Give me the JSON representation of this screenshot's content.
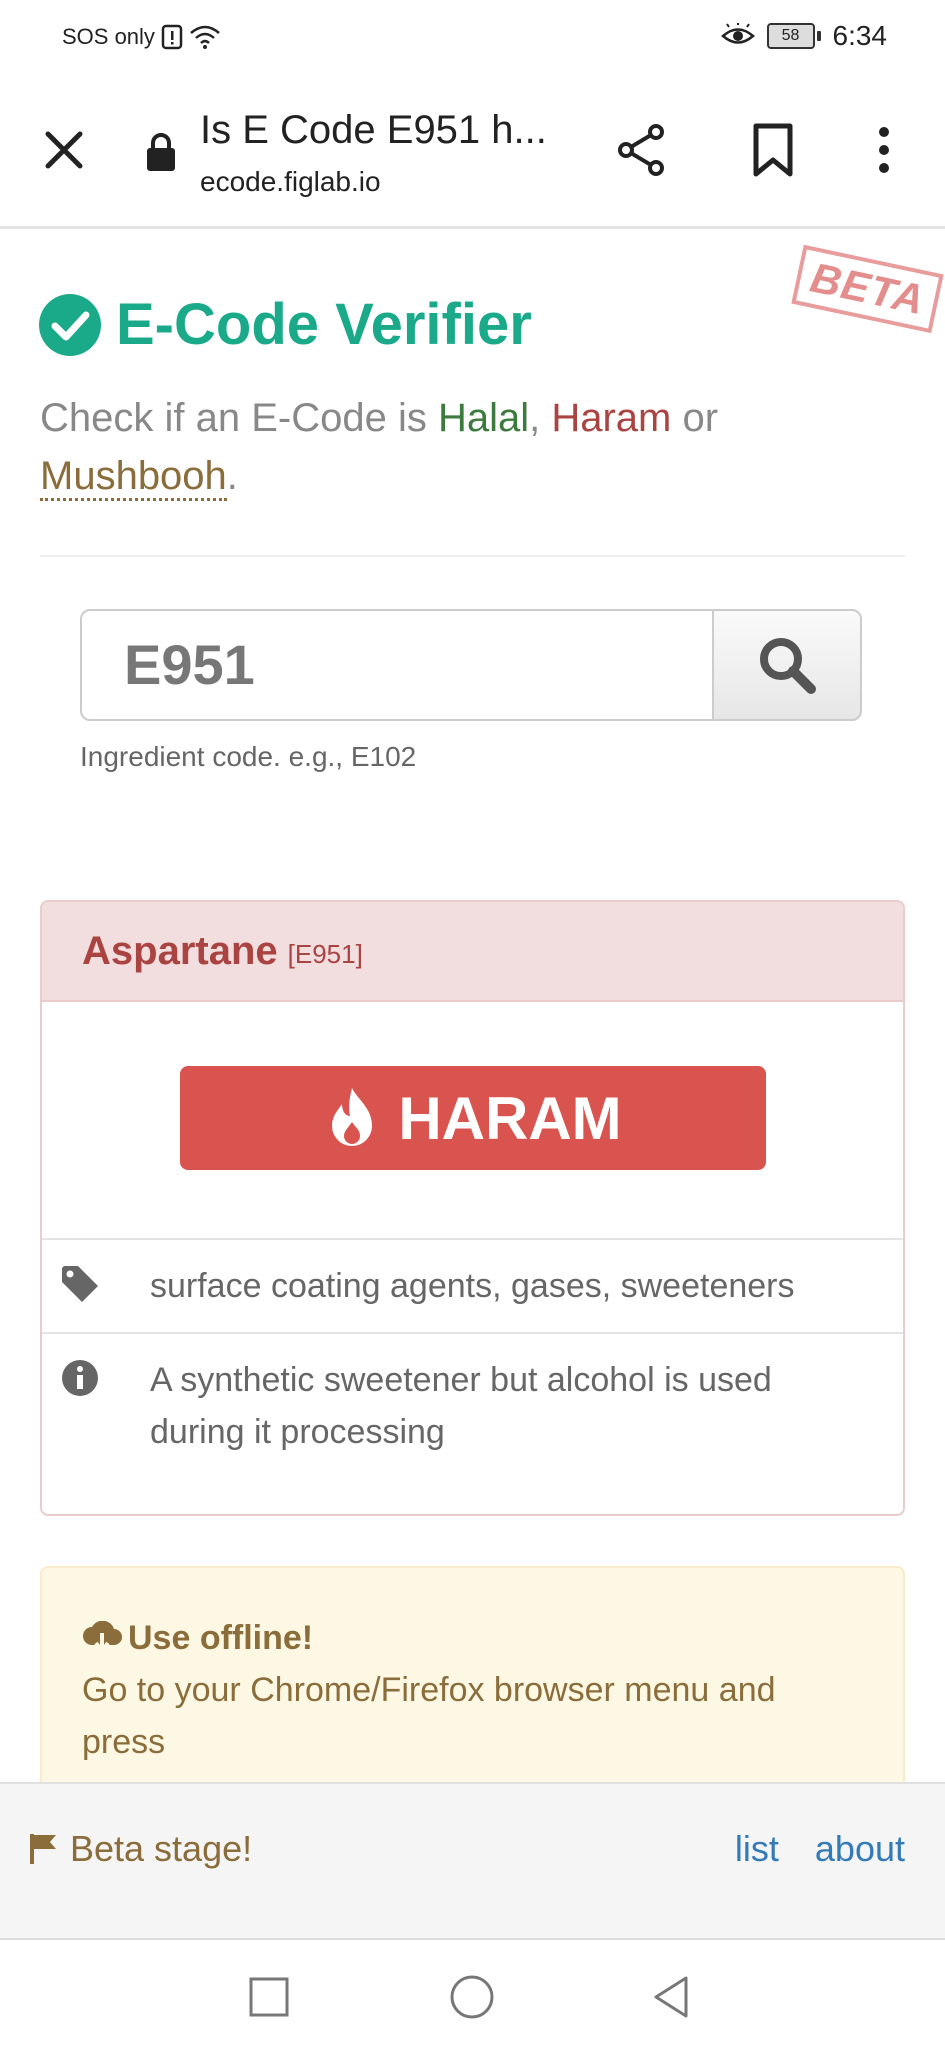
{
  "status_bar": {
    "carrier": "SOS only",
    "battery": "58",
    "time": "6:34"
  },
  "browser": {
    "title": "Is E Code E951 h...",
    "url": "ecode.figlab.io"
  },
  "page": {
    "beta_stamp": "BETA",
    "heading": "E-Code Verifier",
    "subtitle": {
      "prefix": "Check if an E-Code is ",
      "halal": "Halal",
      "sep1": ", ",
      "haram": "Haram",
      "sep2": " or ",
      "mushbooh": "Mushbooh",
      "suffix": "."
    },
    "search": {
      "value": "E951",
      "help": "Ingredient code. e.g., E102"
    },
    "result": {
      "name": "Aspartane",
      "code": "[E951]",
      "verdict": "HARAM",
      "categories": "surface coating agents, gases, sweeteners",
      "info": "A synthetic sweetener but alcohol is used during it processing"
    },
    "offline": {
      "title": "Use offline!",
      "text": "Go to your Chrome/Firefox browser menu and press"
    }
  },
  "footer": {
    "beta_note": "Beta stage!",
    "links": [
      "list",
      "about"
    ]
  },
  "colors": {
    "brand": "#1aaa8a",
    "haram": "#d9534f",
    "halal": "#3d7a3d",
    "mushbooh": "#8a6d3b"
  }
}
